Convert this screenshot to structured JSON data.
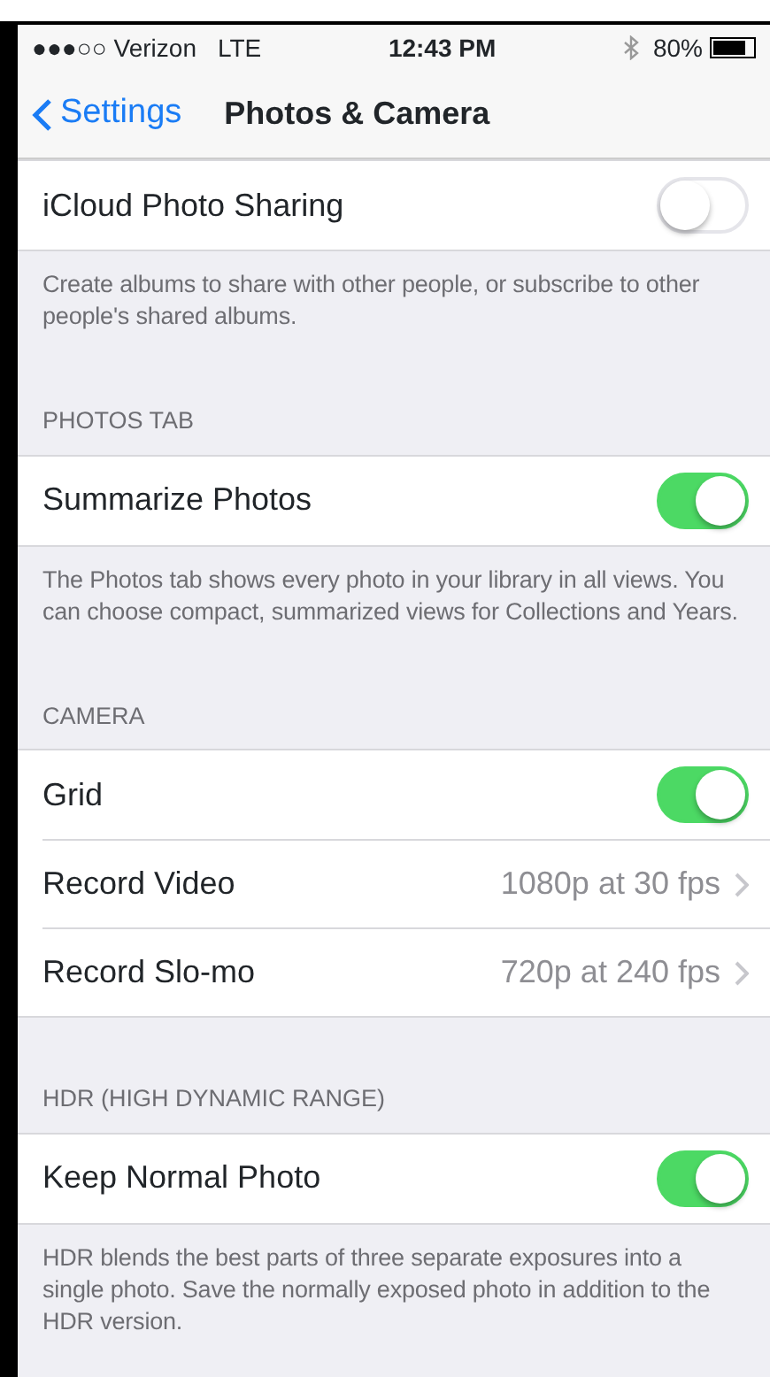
{
  "status_bar": {
    "signal": "●●●○○",
    "carrier": "Verizon",
    "network": "LTE",
    "time": "12:43 PM",
    "battery": "80%"
  },
  "nav": {
    "back": "Settings",
    "title": "Photos & Camera"
  },
  "sections": [
    {
      "rows": [
        {
          "kind": "toggle",
          "label": "iCloud Photo Sharing",
          "on": false
        }
      ],
      "footer": "Create albums to share with other people, or subscribe to other people's shared albums."
    },
    {
      "header": "PHOTOS TAB",
      "rows": [
        {
          "kind": "toggle",
          "label": "Summarize Photos",
          "on": true
        }
      ],
      "footer": "The Photos tab shows every photo in your library in all views. You can choose compact, summarized views for Collections and Years."
    },
    {
      "header": "CAMERA",
      "rows": [
        {
          "kind": "toggle",
          "label": "Grid",
          "on": true
        },
        {
          "kind": "disclosure",
          "label": "Record Video",
          "value": "1080p at 30 fps"
        },
        {
          "kind": "disclosure",
          "label": "Record Slo-mo",
          "value": "720p at 240 fps"
        }
      ]
    },
    {
      "header": "HDR (HIGH DYNAMIC RANGE)",
      "rows": [
        {
          "kind": "toggle",
          "label": "Keep Normal Photo",
          "on": true
        }
      ],
      "footer": "HDR blends the best parts of three separate exposures into a single photo. Save the normally exposed photo in addition to the HDR version."
    }
  ]
}
